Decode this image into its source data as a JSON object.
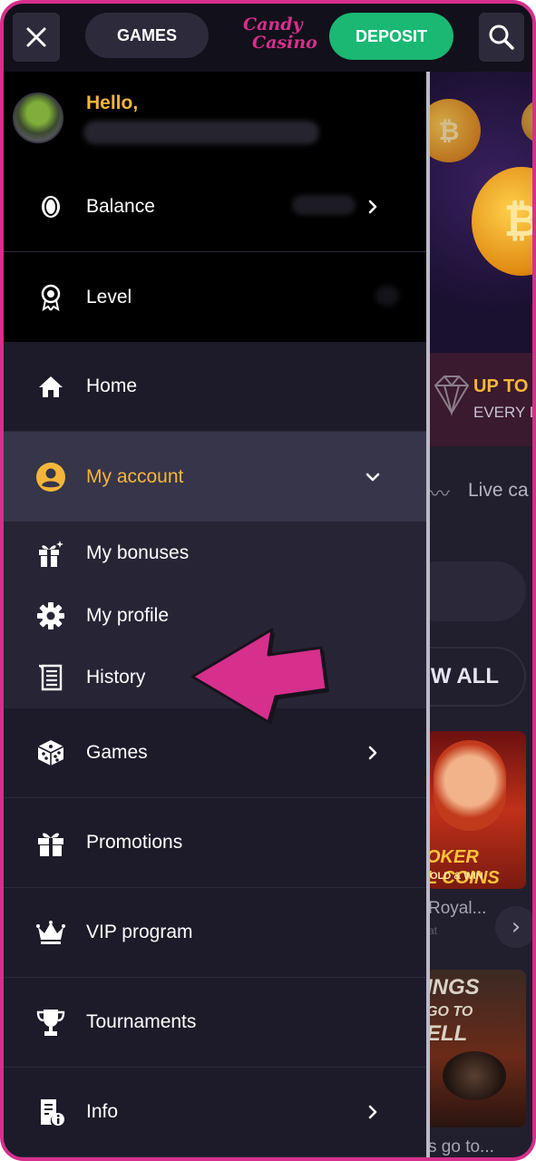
{
  "header": {
    "games_label": "GAMES",
    "logo_line1": "Candy",
    "logo_line2": "Casino",
    "deposit_label": "DEPOSIT"
  },
  "profile": {
    "greeting": "Hello,"
  },
  "menu": {
    "balance": "Balance",
    "level": "Level",
    "home": "Home",
    "my_account": "My account",
    "my_bonuses": "My bonuses",
    "my_profile": "My profile",
    "history": "History",
    "games": "Games",
    "promotions": "Promotions",
    "vip_program": "VIP program",
    "tournaments": "Tournaments",
    "info": "Info"
  },
  "background": {
    "promo_title": "UP TO",
    "promo_subtitle": "EVERY D",
    "live_tab": "Live ca",
    "view_all": "W ALL",
    "game1_title": "OKER",
    "game1_title2": "L COINS",
    "game1_tag": "OLD & WIN",
    "game1_name": "Royal...",
    "game1_sub": "at",
    "game2_title_l1": "INGS",
    "game2_title_l2": "GO TO",
    "game2_title_l3": "ELL",
    "game2_name": "s go to..."
  },
  "colors": {
    "accent_pink": "#d62f8c",
    "deposit_green": "#1ab873",
    "highlight_yellow": "#f4b63a",
    "menu_bg": "#1d1b29"
  }
}
